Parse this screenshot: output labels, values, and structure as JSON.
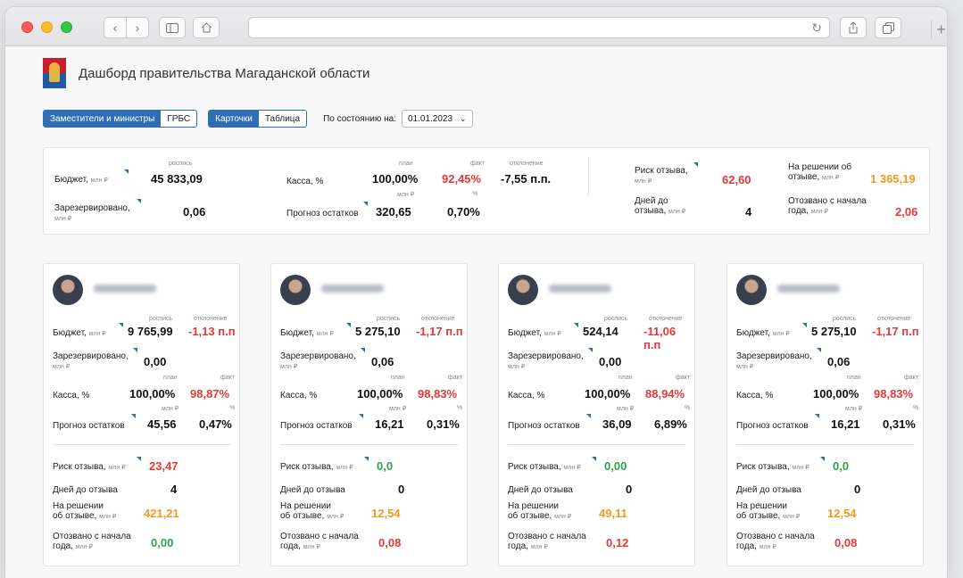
{
  "browser": {
    "nav": {
      "back_icon": "chevron-left-icon",
      "forward_icon": "chevron-right-icon"
    }
  },
  "app": {
    "title": "Дашборд правительства Магаданской области"
  },
  "controls": {
    "group_tabs": [
      "Заместители и министры",
      "ГРБС"
    ],
    "view_tabs": [
      "Карточки",
      "Таблица"
    ],
    "as_of_label": "По состоянию на:",
    "date": "01.01.2023"
  },
  "summary": {
    "budget_label": "Бюджет,",
    "budget_unit": "млн ₽",
    "budget_col": "роспись",
    "budget_value": "45 833,09",
    "reserved_label": "Зарезервировано,",
    "reserved_unit": "млн ₽",
    "reserved_value": "0,06",
    "cash_label": "Касса, %",
    "cash_col_plan": "план",
    "cash_col_fact": "факт",
    "cash_col_dev": "отклонение",
    "cash_plan": "100,00%",
    "cash_fact": "92,45%",
    "cash_dev": "-7,55 п.п.",
    "forecast_label": "Прогноз остатков",
    "forecast_col_mln": "млн ₽",
    "forecast_col_pct": "%",
    "forecast_mln": "320,65",
    "forecast_pct": "0,70%",
    "risk_label": "Риск отзыва,",
    "risk_unit": "млн ₽",
    "risk_value": "62,60",
    "days_label": "Дней до",
    "days_label2": "отзыва,",
    "days_unit": "млн ₽",
    "days_value": "4",
    "decision_label": "На решении об",
    "decision_label2": "отзыве,",
    "decision_unit": "млн ₽",
    "decision_value": "1 365,19",
    "revoked_label": "Отозвано с начала",
    "revoked_label2": "года,",
    "revoked_unit": "млн ₽",
    "revoked_value": "2,06"
  },
  "card_labels": {
    "col_rospis": "роспись",
    "col_dev": "отклонение",
    "budget": "Бюджет,",
    "mln": "млн ₽",
    "reserved": "Зарезервировано,",
    "col_plan": "план",
    "col_fact": "факт",
    "cash": "Касса, %",
    "col_mln": "млн ₽",
    "col_pct": "%",
    "forecast": "Прогноз остатков",
    "risk": "Риск отзыва,",
    "days": "Дней до отзыва",
    "decision": "На решении",
    "decision2": "об отзыве,",
    "revoked": "Отозвано с начала",
    "revoked2": "года,"
  },
  "cards": [
    {
      "budget": "9 765,99",
      "dev": "-1,13 п.п",
      "reserved": "0,00",
      "plan": "100,00%",
      "fact": "98,87%",
      "forecast_mln": "45,56",
      "forecast_pct": "0,47%",
      "risk": "23,47",
      "risk_color": "#e53935",
      "days": "4",
      "decision": "421,21",
      "revoked": "0,00",
      "revoked_color": "#2aa44b"
    },
    {
      "budget": "5 275,10",
      "dev": "-1,17 п.п",
      "reserved": "0,06",
      "plan": "100,00%",
      "fact": "98,83%",
      "forecast_mln": "16,21",
      "forecast_pct": "0,31%",
      "risk": "0,0",
      "risk_color": "#2aa44b",
      "days": "0",
      "decision": "12,54",
      "revoked": "0,08",
      "revoked_color": "#e53935"
    },
    {
      "budget": "524,14",
      "dev": "-11,06 п.п",
      "reserved": "0,00",
      "plan": "100,00%",
      "fact": "88,94%",
      "forecast_mln": "36,09",
      "forecast_pct": "6,89%",
      "risk": "0,00",
      "risk_color": "#2aa44b",
      "days": "0",
      "decision": "49,11",
      "revoked": "0,12",
      "revoked_color": "#e53935"
    },
    {
      "budget": "5 275,10",
      "dev": "-1,17 п.п",
      "reserved": "0,06",
      "plan": "100,00%",
      "fact": "98,83%",
      "forecast_mln": "16,21",
      "forecast_pct": "0,31%",
      "risk": "0,0",
      "risk_color": "#2aa44b",
      "days": "0",
      "decision": "12,54",
      "revoked": "0,08",
      "revoked_color": "#e53935"
    }
  ],
  "colors": {
    "accent": "#2f6db5",
    "red": "#e53935",
    "orange": "#f39a1c",
    "green": "#2aa44b"
  }
}
